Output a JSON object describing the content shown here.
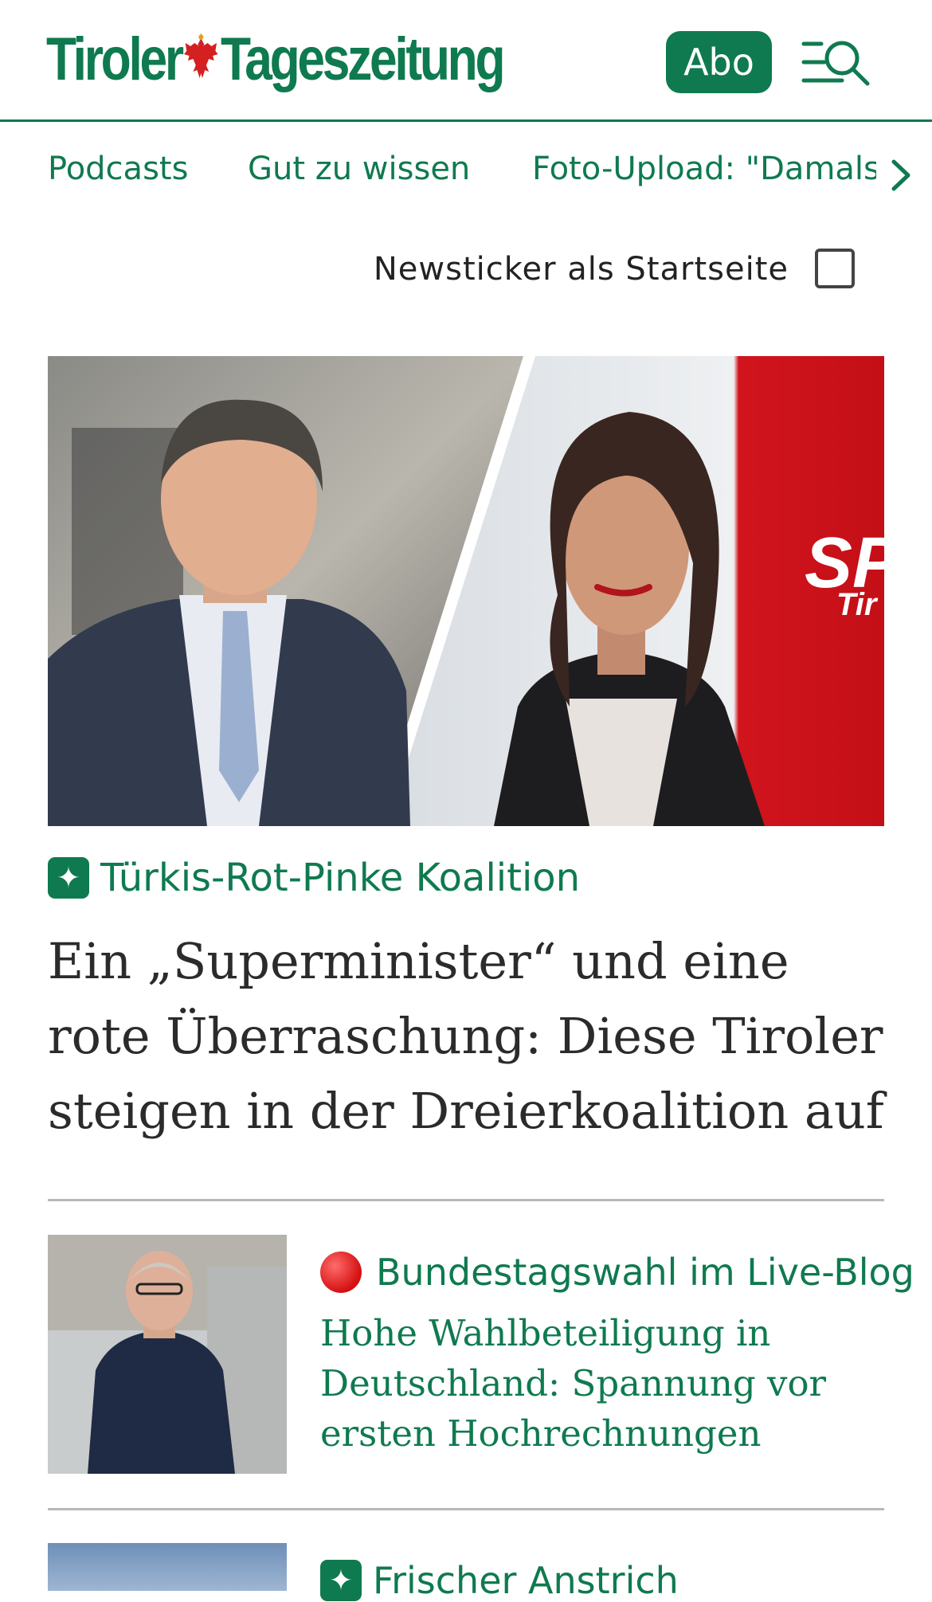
{
  "brand": {
    "name_part1": "Tiroler",
    "name_part2": "Tageszeitung",
    "color": "#0f7a4f"
  },
  "header": {
    "abo_label": "Abo",
    "menu_icon": "menu-search-icon"
  },
  "nav": {
    "items": [
      {
        "label": "Podcasts"
      },
      {
        "label": "Gut zu wissen"
      },
      {
        "label": "Foto-Upload: \"Damals"
      }
    ],
    "scroll_icon": "chevron-right-icon"
  },
  "ticker": {
    "label": "Newsticker als Startseite",
    "checked": false
  },
  "hero": {
    "image_description": "two politicians split image",
    "kicker_icon": "plus-badge-icon",
    "kicker": "Türkis-Rot-Pinke Koalition",
    "title": "Ein „Superminister“ und eine rote Überraschung: Diese Tiroler steigen in der Dreierkoalition auf"
  },
  "articles": [
    {
      "kicker_icon": "red-circle-icon",
      "kicker": "Bundestagswahl im Live-Blog",
      "title": "Hohe Wahlbeteiligung in Deutschland: Spannung vor ersten Hochrechnungen"
    },
    {
      "kicker_icon": "plus-badge-icon",
      "kicker": "Frischer Anstrich"
    }
  ]
}
